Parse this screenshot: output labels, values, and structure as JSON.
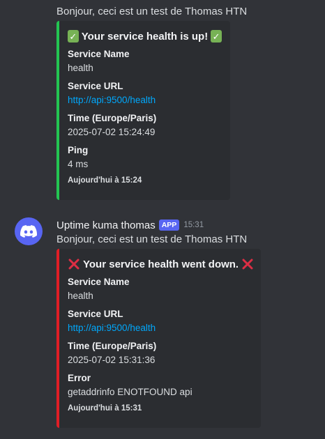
{
  "message1": {
    "text": "Bonjour, ceci est un test de Thomas HTN",
    "embed": {
      "title": "Your service health is up!",
      "fields": [
        {
          "name": "Service Name",
          "value": "health"
        },
        {
          "name": "Service URL",
          "value": "http://api:9500/health"
        },
        {
          "name": "Time (Europe/Paris)",
          "value": "2025-07-02 15:24:49"
        },
        {
          "name": "Ping",
          "value": "4 ms"
        }
      ],
      "footer": "Aujourd'hui à 15:24",
      "color": "#23c552"
    }
  },
  "message2": {
    "username": "Uptime kuma thomas",
    "badge": "APP",
    "timestamp": "15:31",
    "text": "Bonjour, ceci est un test de Thomas HTN",
    "embed": {
      "title": "Your service health went down.",
      "fields": [
        {
          "name": "Service Name",
          "value": "health"
        },
        {
          "name": "Service URL",
          "value": "http://api:9500/health"
        },
        {
          "name": "Time (Europe/Paris)",
          "value": "2025-07-02 15:31:36"
        },
        {
          "name": "Error",
          "value": "getaddrinfo ENOTFOUND api"
        }
      ],
      "footer": "Aujourd'hui à 15:31",
      "color": "#e01e26"
    }
  },
  "icons": {
    "up": "check-mark-emoji",
    "down": "cross-mark-emoji",
    "avatar": "discord-logo"
  },
  "theme": {
    "background": "#313338",
    "embed_background": "#2b2d31",
    "link": "#00a8fc",
    "badge": "#5865f2"
  }
}
